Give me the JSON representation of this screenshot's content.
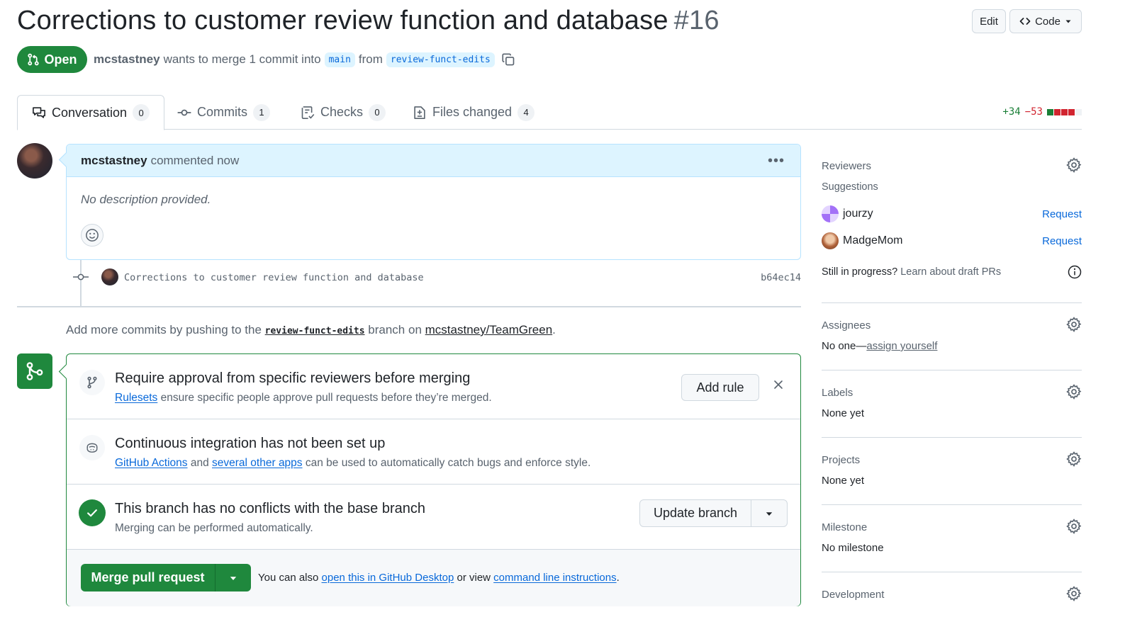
{
  "header": {
    "title": "Corrections to customer review function and database",
    "number": "#16",
    "edit_label": "Edit",
    "code_label": "Code"
  },
  "state": {
    "label": "Open",
    "author": "mcstastney",
    "text_merge": "wants to merge 1 commit into",
    "base_branch": "main",
    "text_from": "from",
    "head_branch": "review-funct-edits"
  },
  "tabs": [
    {
      "label": "Conversation",
      "count": "0"
    },
    {
      "label": "Commits",
      "count": "1"
    },
    {
      "label": "Checks",
      "count": "0"
    },
    {
      "label": "Files changed",
      "count": "4"
    }
  ],
  "diffstat": {
    "additions": "+34",
    "deletions": "−53"
  },
  "comment": {
    "author": "mcstastney",
    "action": "commented now",
    "body": "No description provided."
  },
  "commit": {
    "message": "Corrections to customer review function and database",
    "sha": "b64ec14"
  },
  "hint": {
    "prefix": "Add more commits by pushing to the",
    "branch": "review-funct-edits",
    "middle": "branch on",
    "repo": "mcstastney/TeamGreen",
    "suffix": "."
  },
  "merge_box": {
    "rule_title": "Require approval from specific reviewers before merging",
    "rule_link": "Rulesets",
    "rule_sub": "ensure specific people approve pull requests before they’re merged.",
    "add_rule": "Add rule",
    "ci_title": "Continuous integration has not been set up",
    "ci_link1": "GitHub Actions",
    "ci_and": "and",
    "ci_link2": "several other apps",
    "ci_sub": "can be used to automatically catch bugs and enforce style.",
    "conflict_title": "This branch has no conflicts with the base branch",
    "conflict_sub": "Merging can be performed automatically.",
    "update_branch": "Update branch",
    "merge_button": "Merge pull request",
    "foot_prefix": "You can also",
    "foot_link1": "open this in GitHub Desktop",
    "foot_mid": "or view",
    "foot_link2": "command line instructions",
    "foot_suffix": "."
  },
  "sidebar": {
    "reviewers": {
      "title": "Reviewers",
      "suggestions_label": "Suggestions",
      "suggestions": [
        {
          "name": "jourzy",
          "action": "Request"
        },
        {
          "name": "MadgeMom",
          "action": "Request"
        }
      ],
      "draft_prefix": "Still in progress?",
      "draft_link": "Learn about draft PRs"
    },
    "assignees": {
      "title": "Assignees",
      "prefix": "No one—",
      "link": "assign yourself"
    },
    "labels": {
      "title": "Labels",
      "value": "None yet"
    },
    "projects": {
      "title": "Projects",
      "value": "None yet"
    },
    "milestone": {
      "title": "Milestone",
      "value": "No milestone"
    },
    "development": {
      "title": "Development"
    }
  },
  "colors": {
    "accent_green": "#1f883d",
    "link_blue": "#0969da",
    "addition": "#1a7f37",
    "deletion": "#d1242f"
  },
  "icons": [
    "pull-request-icon",
    "copy-icon",
    "code-icon",
    "comment-discussion-icon",
    "commit-icon",
    "checklist-icon",
    "file-diff-icon",
    "kebab-horizontal-icon",
    "smiley-icon",
    "git-merge-icon",
    "git-branch-icon",
    "copilot-icon",
    "check-icon",
    "triangle-down-icon",
    "gear-icon",
    "info-icon",
    "x-icon"
  ]
}
